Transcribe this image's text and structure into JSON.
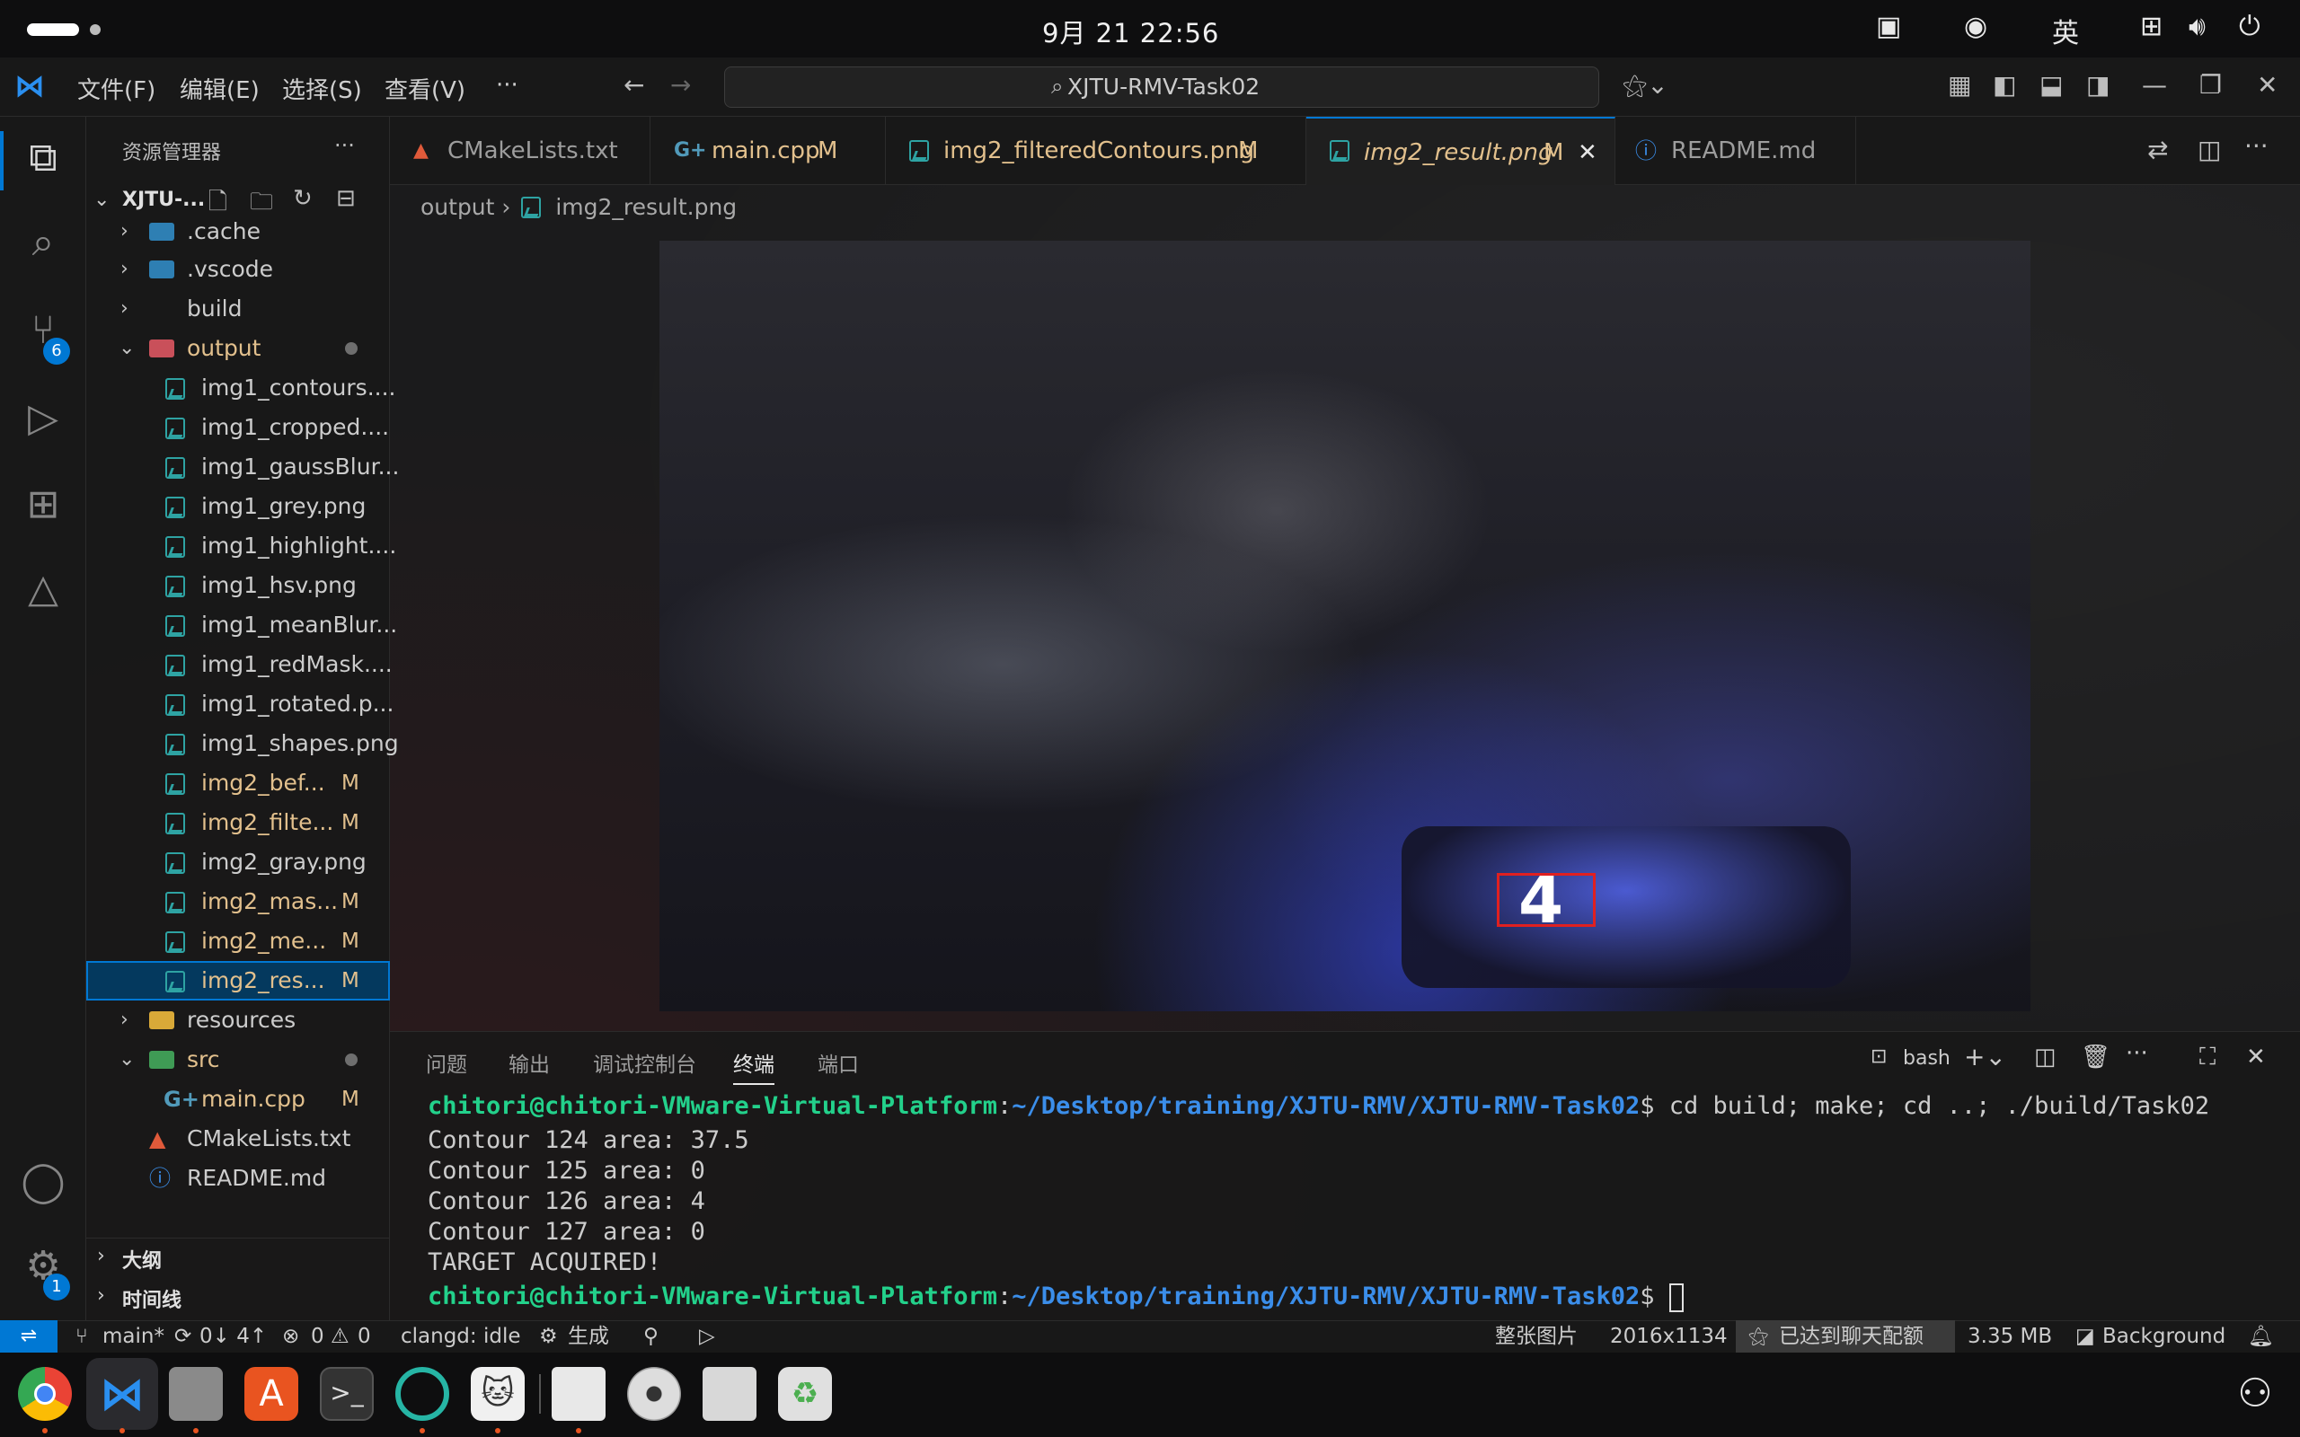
{
  "system_bar": {
    "clock": "9月 21  22:56",
    "input_method": "英"
  },
  "menu": {
    "items": [
      "文件(F)",
      "编辑(E)",
      "选择(S)",
      "查看(V)"
    ],
    "more": "···"
  },
  "command_center": {
    "text": "XJTU-RMV-Task02"
  },
  "activity_bar": {
    "source_control_badge": "6",
    "settings_badge": "1"
  },
  "explorer": {
    "title": "资源管理器",
    "more": "···",
    "root": "XJTU-...",
    "items": [
      {
        "label": ".cache",
        "type": "folder",
        "mod": ""
      },
      {
        "label": ".vscode",
        "type": "folder",
        "mod": ""
      },
      {
        "label": "build",
        "type": "folder",
        "mod": ""
      },
      {
        "label": "output",
        "type": "folder-open",
        "mod": ""
      },
      {
        "label": "img1_contours....",
        "type": "image",
        "mod": ""
      },
      {
        "label": "img1_cropped....",
        "type": "image",
        "mod": ""
      },
      {
        "label": "img1_gaussBlur...",
        "type": "image",
        "mod": ""
      },
      {
        "label": "img1_grey.png",
        "type": "image",
        "mod": ""
      },
      {
        "label": "img1_highlight....",
        "type": "image",
        "mod": ""
      },
      {
        "label": "img1_hsv.png",
        "type": "image",
        "mod": ""
      },
      {
        "label": "img1_meanBlur...",
        "type": "image",
        "mod": ""
      },
      {
        "label": "img1_redMask....",
        "type": "image",
        "mod": ""
      },
      {
        "label": "img1_rotated.p...",
        "type": "image",
        "mod": ""
      },
      {
        "label": "img1_shapes.png",
        "type": "image",
        "mod": ""
      },
      {
        "label": "img2_bef...",
        "type": "image",
        "mod": "M"
      },
      {
        "label": "img2_filte...",
        "type": "image",
        "mod": "M"
      },
      {
        "label": "img2_gray.png",
        "type": "image",
        "mod": ""
      },
      {
        "label": "img2_mas...",
        "type": "image",
        "mod": "M"
      },
      {
        "label": "img2_me...",
        "type": "image",
        "mod": "M"
      },
      {
        "label": "img2_res...",
        "type": "image",
        "mod": "M"
      },
      {
        "label": "resources",
        "type": "folder",
        "mod": ""
      },
      {
        "label": "src",
        "type": "folder-open",
        "mod": ""
      },
      {
        "label": "main.cpp",
        "type": "cpp",
        "mod": "M"
      },
      {
        "label": "CMakeLists.txt",
        "type": "cmake",
        "mod": ""
      },
      {
        "label": "README.md",
        "type": "info",
        "mod": ""
      }
    ],
    "outline": "大纲",
    "timeline": "时间线"
  },
  "tabs": [
    {
      "label": "CMakeLists.txt",
      "mod": ""
    },
    {
      "label": "main.cpp",
      "mod": "M"
    },
    {
      "label": "img2_filteredContours.png",
      "mod": "M"
    },
    {
      "label": "img2_result.png",
      "mod": "M"
    },
    {
      "label": "README.md",
      "mod": ""
    }
  ],
  "breadcrumb": {
    "folder": "output",
    "file": "img2_result.png"
  },
  "preview": {
    "target_digit": "4"
  },
  "panel": {
    "tabs": [
      "问题",
      "输出",
      "调试控制台",
      "终端",
      "端口"
    ],
    "active_tab": "终端",
    "shell": "bash",
    "terminal": {
      "user": "chitori@chitori-VMware-Virtual-Platform",
      "path": "~/Desktop/training/XJTU-RMV/XJTU-RMV-Task02",
      "command": " cd build; make; cd ..; ./build/Task02",
      "lines": [
        "Contour 124 area: 37.5",
        "Contour 125 area: 0",
        "Contour 126 area: 4",
        "Contour 127 area: 0",
        "TARGET ACQUIRED!"
      ]
    }
  },
  "status_bar": {
    "branch": "main*",
    "sync": "0↓ 4↑",
    "errors": "0",
    "warnings": "0",
    "clangd": "clangd: idle",
    "build": "生成",
    "zoom": "整张图片",
    "dimensions": "2016x1134",
    "chat_limit": "已达到聊天配额",
    "size": "3.35 MB",
    "background": "Background"
  }
}
